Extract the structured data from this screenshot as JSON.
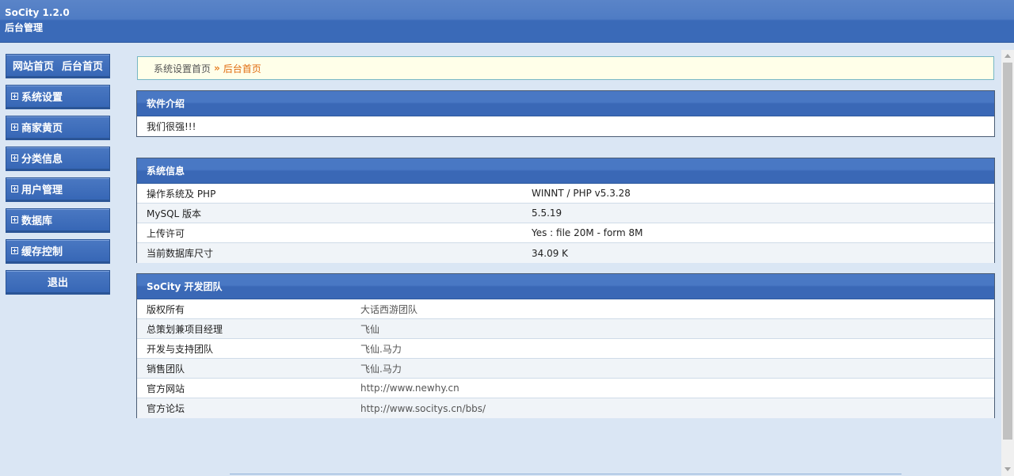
{
  "header": {
    "title": "SoCity 1.2.0",
    "subtitle": "后台管理"
  },
  "sidebar": {
    "top": {
      "left": "网站首页",
      "right": "后台首页"
    },
    "items": [
      {
        "label": "系统设置"
      },
      {
        "label": "商家黄页"
      },
      {
        "label": "分类信息"
      },
      {
        "label": "用户管理"
      },
      {
        "label": "数据库"
      },
      {
        "label": "缓存控制"
      }
    ],
    "logout": "退出"
  },
  "breadcrumb": {
    "parent": "系统设置首页",
    "sep": "»",
    "current": "后台首页"
  },
  "intro": {
    "title": "软件介绍",
    "text": "我们很强!!!"
  },
  "sysinfo": {
    "title": "系统信息",
    "rows": [
      {
        "k": "操作系统及 PHP",
        "v": "WINNT / PHP v5.3.28"
      },
      {
        "k": "MySQL 版本",
        "v": "5.5.19"
      },
      {
        "k": "上传许可",
        "v": "Yes : file 20M - form 8M"
      },
      {
        "k": "当前数据库尺寸",
        "v": "34.09 K"
      }
    ]
  },
  "team": {
    "title": "SoCity 开发团队",
    "rows": [
      {
        "k": "版权所有",
        "v": "大话西游团队"
      },
      {
        "k": "总策划兼项目经理",
        "v": "飞仙"
      },
      {
        "k": "开发与支持团队",
        "v": "飞仙.马力"
      },
      {
        "k": "销售团队",
        "v": "飞仙.马力"
      },
      {
        "k": "官方网站",
        "v": "http://www.newhy.cn"
      },
      {
        "k": "官方论坛",
        "v": "http://www.socitys.cn/bbs/"
      }
    ]
  }
}
